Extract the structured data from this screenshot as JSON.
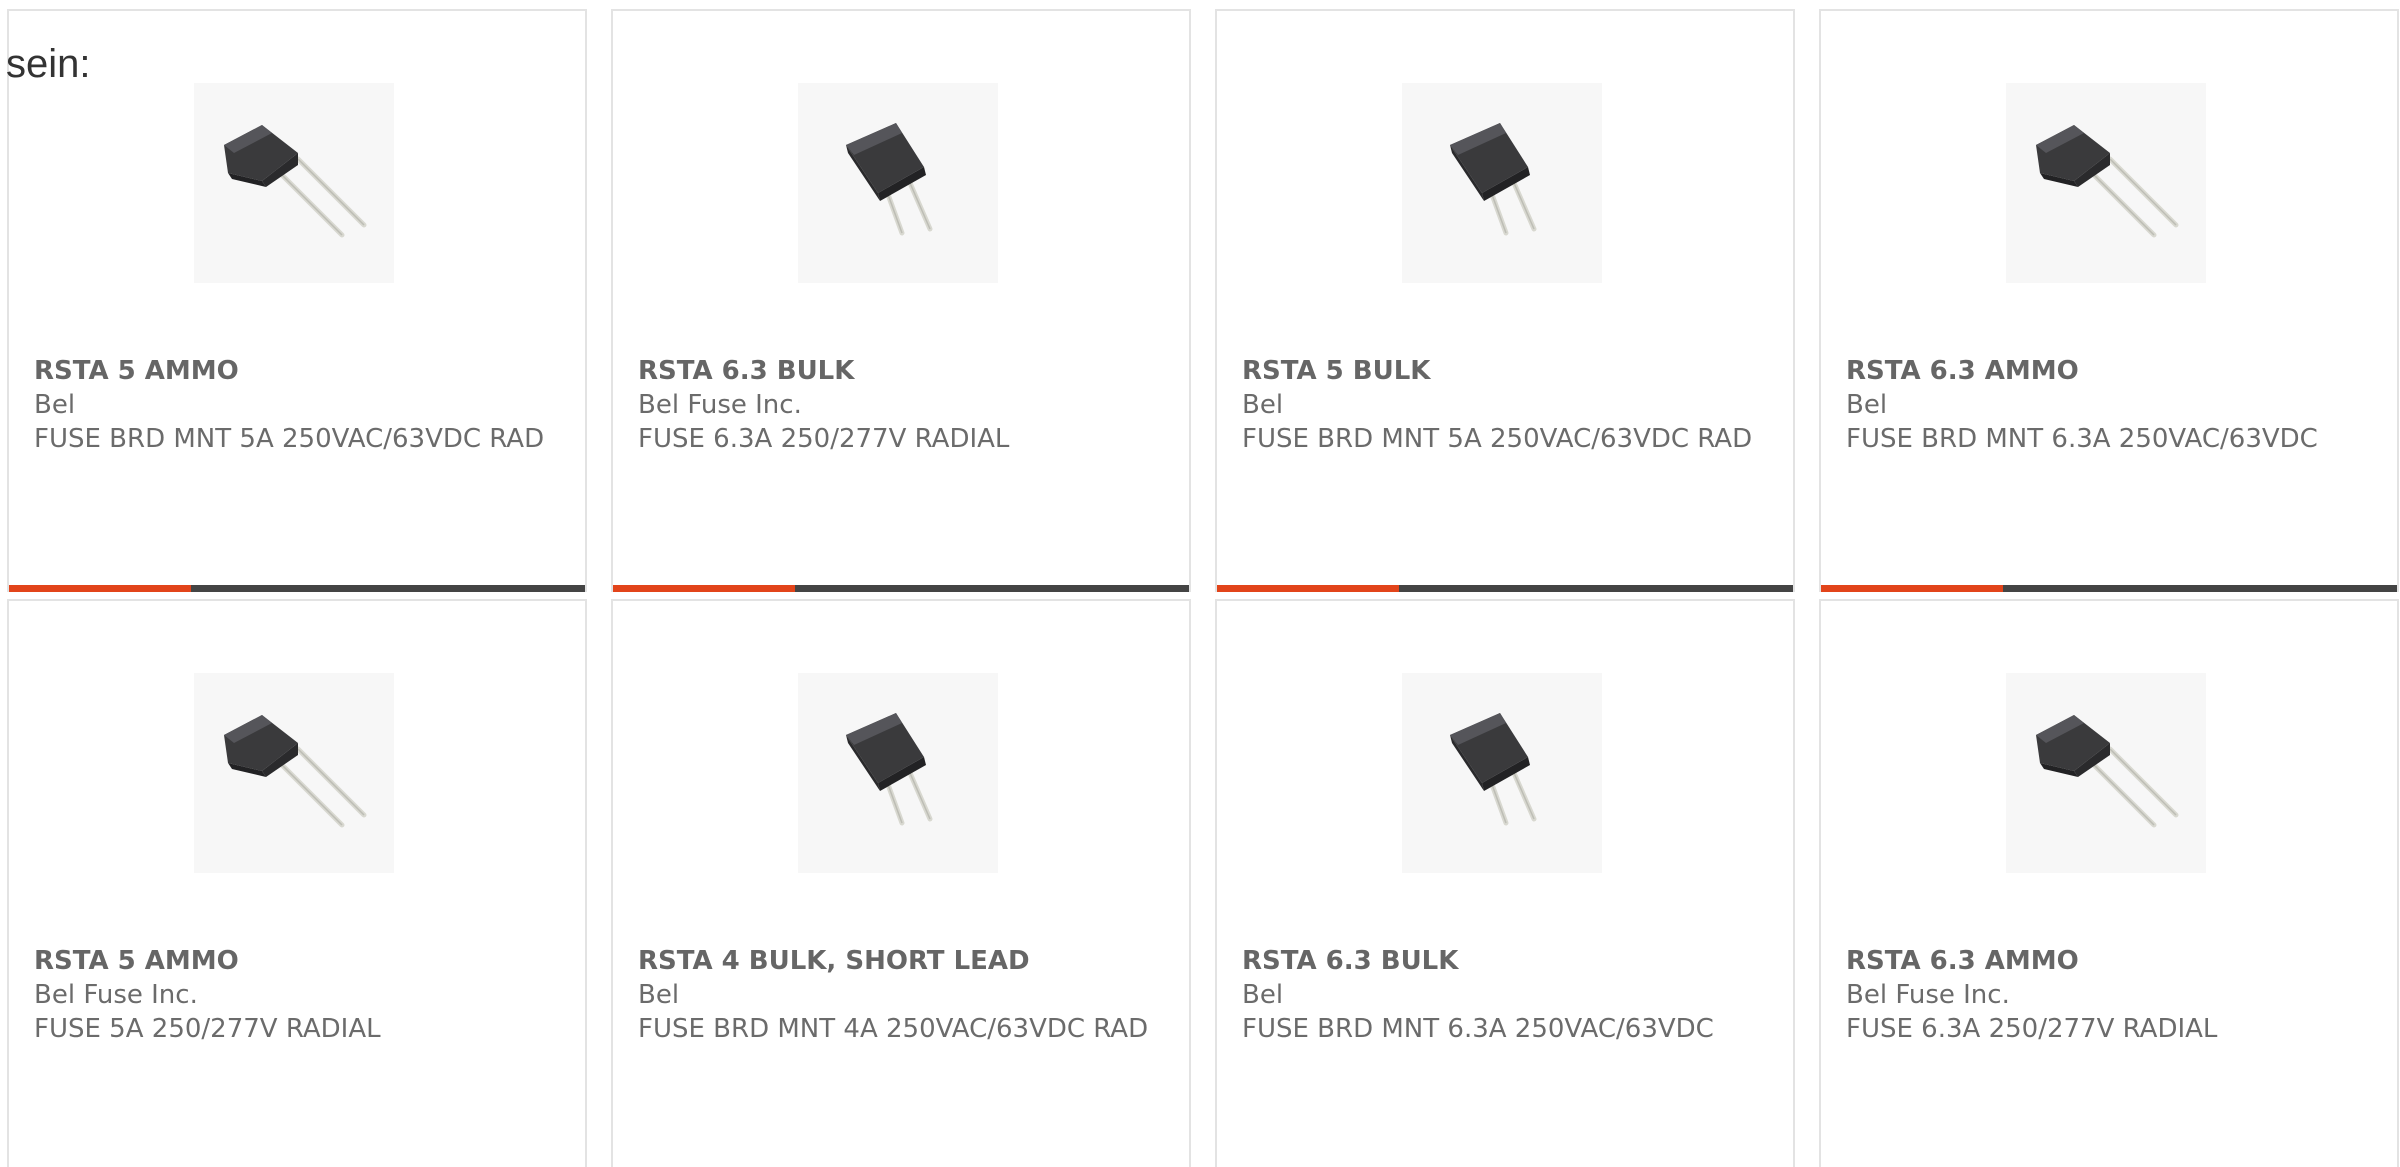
{
  "intro": {
    "text": "sein:"
  },
  "colors": {
    "accent": "#e2441a",
    "bar_dark": "#444444",
    "text": "#666666",
    "border": "#e3e3e3"
  },
  "products": [
    {
      "part_number": "RSTA 5 AMMO",
      "manufacturer": "Bel",
      "description": "FUSE BRD MNT 5A 250VAC/63VDC RAD",
      "image_icon": "radial-fuse-image",
      "pose": "angled"
    },
    {
      "part_number": "RSTA 6.3 BULK",
      "manufacturer": "Bel Fuse Inc.",
      "description": "FUSE 6.3A 250/277V RADIAL",
      "image_icon": "radial-fuse-image",
      "pose": "upright"
    },
    {
      "part_number": "RSTA 5 BULK",
      "manufacturer": "Bel",
      "description": "FUSE BRD MNT 5A 250VAC/63VDC RAD",
      "image_icon": "radial-fuse-image",
      "pose": "upright"
    },
    {
      "part_number": "RSTA 6.3 AMMO",
      "manufacturer": "Bel",
      "description": "FUSE BRD MNT 6.3A 250VAC/63VDC",
      "image_icon": "radial-fuse-image",
      "pose": "angled"
    },
    {
      "part_number": "RSTA 5 AMMO",
      "manufacturer": "Bel Fuse Inc.",
      "description": "FUSE 5A 250/277V RADIAL",
      "image_icon": "radial-fuse-image",
      "pose": "angled"
    },
    {
      "part_number": "RSTA 4 BULK, SHORT LEAD",
      "manufacturer": "Bel",
      "description": "FUSE BRD MNT 4A 250VAC/63VDC RAD",
      "image_icon": "radial-fuse-image",
      "pose": "upright"
    },
    {
      "part_number": "RSTA 6.3 BULK",
      "manufacturer": "Bel",
      "description": "FUSE BRD MNT 6.3A 250VAC/63VDC",
      "image_icon": "radial-fuse-image",
      "pose": "upright"
    },
    {
      "part_number": "RSTA 6.3 AMMO",
      "manufacturer": "Bel Fuse Inc.",
      "description": "FUSE 6.3A 250/277V RADIAL",
      "image_icon": "radial-fuse-image",
      "pose": "angled"
    }
  ]
}
